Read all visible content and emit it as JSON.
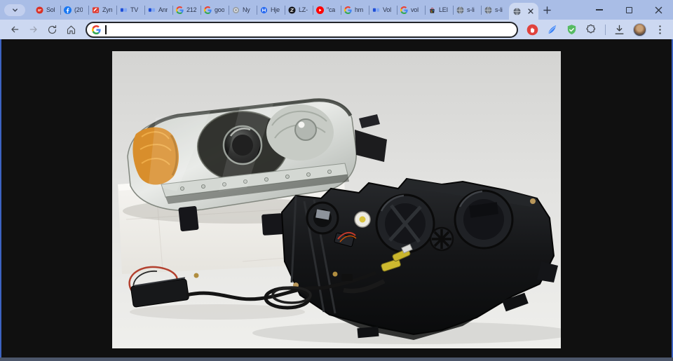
{
  "theme": {
    "tab_strip_bg": "#a9bde6",
    "toolbar_bg": "#ccd8f1",
    "content_bg": "#101010",
    "address_focus_ring": "#23252a",
    "window_bottom_edge": "#4c566a"
  },
  "tab_strip": {
    "tabs": [
      {
        "title": "Sol",
        "icon": "red-badge-icon"
      },
      {
        "title": "(20",
        "icon": "facebook-icon"
      },
      {
        "title": "Zyn",
        "icon": "red-flag-icon"
      },
      {
        "title": "TV",
        "icon": "blue-squares-icon"
      },
      {
        "title": "Anr",
        "icon": "blue-squares-icon"
      },
      {
        "title": "212",
        "icon": "google-icon"
      },
      {
        "title": "goo",
        "icon": "google-icon"
      },
      {
        "title": "Ny",
        "icon": "chrome-gray-icon"
      },
      {
        "title": "Hje",
        "icon": "blue-logo-icon"
      },
      {
        "title": "LZ-",
        "icon": "dark-logo-icon"
      },
      {
        "title": "\"ca",
        "icon": "youtube-icon"
      },
      {
        "title": "hm",
        "icon": "google-icon"
      },
      {
        "title": "Vol",
        "icon": "blue-squares-icon"
      },
      {
        "title": "vol",
        "icon": "google-icon"
      },
      {
        "title": "LEI",
        "icon": "shopping-bag-icon"
      },
      {
        "title": "s-li",
        "icon": "globe-icon"
      },
      {
        "title": "s-li",
        "icon": "globe-icon"
      },
      {
        "title": "",
        "icon": "globe-icon",
        "active": true
      }
    ]
  },
  "toolbar": {
    "address_bar": {
      "value": "",
      "engine_icon": "google-g-icon"
    },
    "icons": [
      "back-arrow-icon",
      "forward-arrow-icon",
      "reload-icon",
      "home-icon",
      "hand-stop-extension-icon",
      "feather-extension-icon",
      "shield-check-extension-icon",
      "puzzle-extensions-icon",
      "download-icon",
      "avatar",
      "kebab-menu-icon"
    ]
  },
  "window_controls": {
    "icons": [
      "minimize-icon",
      "maximize-icon",
      "close-icon"
    ]
  }
}
